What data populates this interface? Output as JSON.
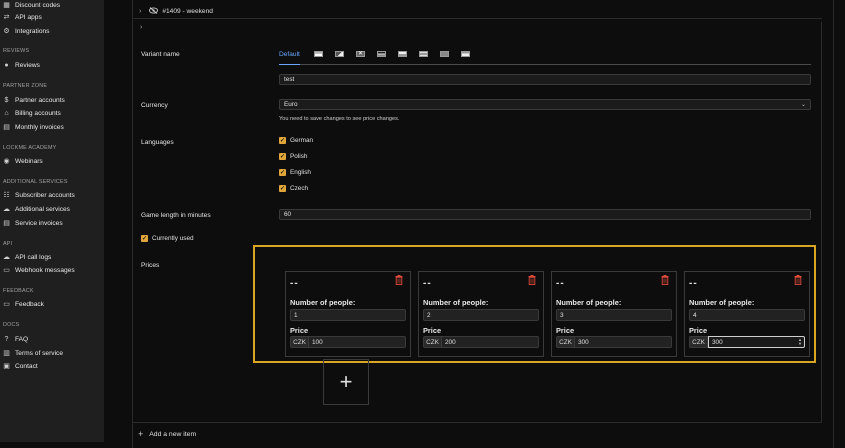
{
  "sidebar": {
    "items_top": [
      {
        "label": "Discount codes",
        "icon": "grid-icon"
      },
      {
        "label": "API apps",
        "icon": "code-icon"
      },
      {
        "label": "Integrations",
        "icon": "puzzle-icon"
      }
    ],
    "sections": [
      {
        "title": "REVIEWS",
        "items": [
          {
            "label": "Reviews",
            "icon": "chat-icon"
          }
        ]
      },
      {
        "title": "PARTNER ZONE",
        "items": [
          {
            "label": "Partner accounts",
            "icon": "dollar-icon"
          },
          {
            "label": "Billing accounts",
            "icon": "bank-icon"
          },
          {
            "label": "Monthly invoices",
            "icon": "invoice-icon"
          }
        ]
      },
      {
        "title": "LOCKME ACADEMY",
        "items": [
          {
            "label": "Webinars",
            "icon": "play-icon"
          }
        ]
      },
      {
        "title": "ADDITIONAL SERVICES",
        "items": [
          {
            "label": "Subscriber accounts",
            "icon": "users-icon"
          },
          {
            "label": "Additional services",
            "icon": "cloud-icon"
          },
          {
            "label": "Service invoices",
            "icon": "document-icon"
          }
        ]
      },
      {
        "title": "API",
        "items": [
          {
            "label": "API call logs",
            "icon": "cloud-icon"
          },
          {
            "label": "Webhook messages",
            "icon": "message-icon"
          }
        ]
      },
      {
        "title": "FEEDBACK",
        "items": [
          {
            "label": "Feedback",
            "icon": "feedback-icon"
          }
        ]
      },
      {
        "title": "DOCS",
        "items": [
          {
            "label": "FAQ",
            "icon": "question-icon"
          },
          {
            "label": "Terms of service",
            "icon": "book-icon"
          },
          {
            "label": "Contact",
            "icon": "contact-icon"
          }
        ]
      }
    ]
  },
  "main": {
    "variant_header": "#1409 - weekend",
    "variant_name_label": "Variant name",
    "tabs": {
      "default": "Default"
    },
    "variant_name_value": "test",
    "currency_label": "Currency",
    "currency_value": "Euro",
    "currency_hint": "You need to save changes to see price changes.",
    "languages_label": "Languages",
    "languages": [
      "German",
      "Polish",
      "English",
      "Czech"
    ],
    "game_length_label": "Game length in minutes",
    "game_length_value": "60",
    "currently_used_label": "Currently used",
    "prices_label": "Prices",
    "price_cards": [
      {
        "title": "--",
        "people_label": "Number of people:",
        "people": "1",
        "price_label": "Price",
        "currency": "CZK",
        "price": "100"
      },
      {
        "title": "--",
        "people_label": "Number of people:",
        "people": "2",
        "price_label": "Price",
        "currency": "CZK",
        "price": "200"
      },
      {
        "title": "--",
        "people_label": "Number of people:",
        "people": "3",
        "price_label": "Price",
        "currency": "CZK",
        "price": "300"
      },
      {
        "title": "--",
        "people_label": "Number of people:",
        "people": "4",
        "price_label": "Price",
        "currency": "CZK",
        "price": "300"
      }
    ],
    "add_price_symbol": "+",
    "add_item_label": "Add a new item"
  },
  "colors": {
    "accent_border": "#d9a621",
    "checkbox": "#e0a63a",
    "tab_active": "#6aa8ff",
    "trash": "#e04a3a"
  }
}
